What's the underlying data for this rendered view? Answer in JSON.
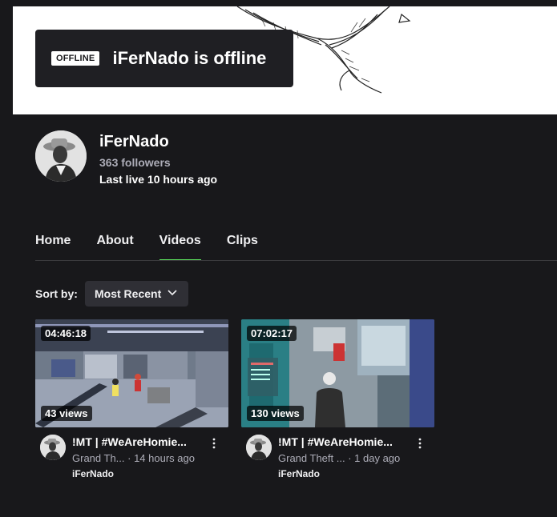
{
  "banner": {
    "offline_badge": "OFFLINE",
    "offline_text": "iFerNado is offline"
  },
  "channel": {
    "name": "iFerNado",
    "followers": "363 followers",
    "last_live": "Last live 10 hours ago"
  },
  "tabs": [
    {
      "label": "Home"
    },
    {
      "label": "About"
    },
    {
      "label": "Videos",
      "active": true
    },
    {
      "label": "Clips"
    }
  ],
  "sort": {
    "label": "Sort by:",
    "value": "Most Recent"
  },
  "videos": [
    {
      "duration": "04:46:18",
      "views": "43 views",
      "title": "!MT | #WeAreHomie...",
      "game": "Grand Th...",
      "ago": "· 14 hours ago",
      "channel": "iFerNado"
    },
    {
      "duration": "07:02:17",
      "views": "130 views",
      "title": "!MT | #WeAreHomie...",
      "game": "Grand Theft ...",
      "ago": "· 1 day ago",
      "channel": "iFerNado"
    }
  ],
  "colors": {
    "background": "#18181b",
    "accent_underline": "#5ee85f",
    "muted_text": "#adadb8"
  }
}
